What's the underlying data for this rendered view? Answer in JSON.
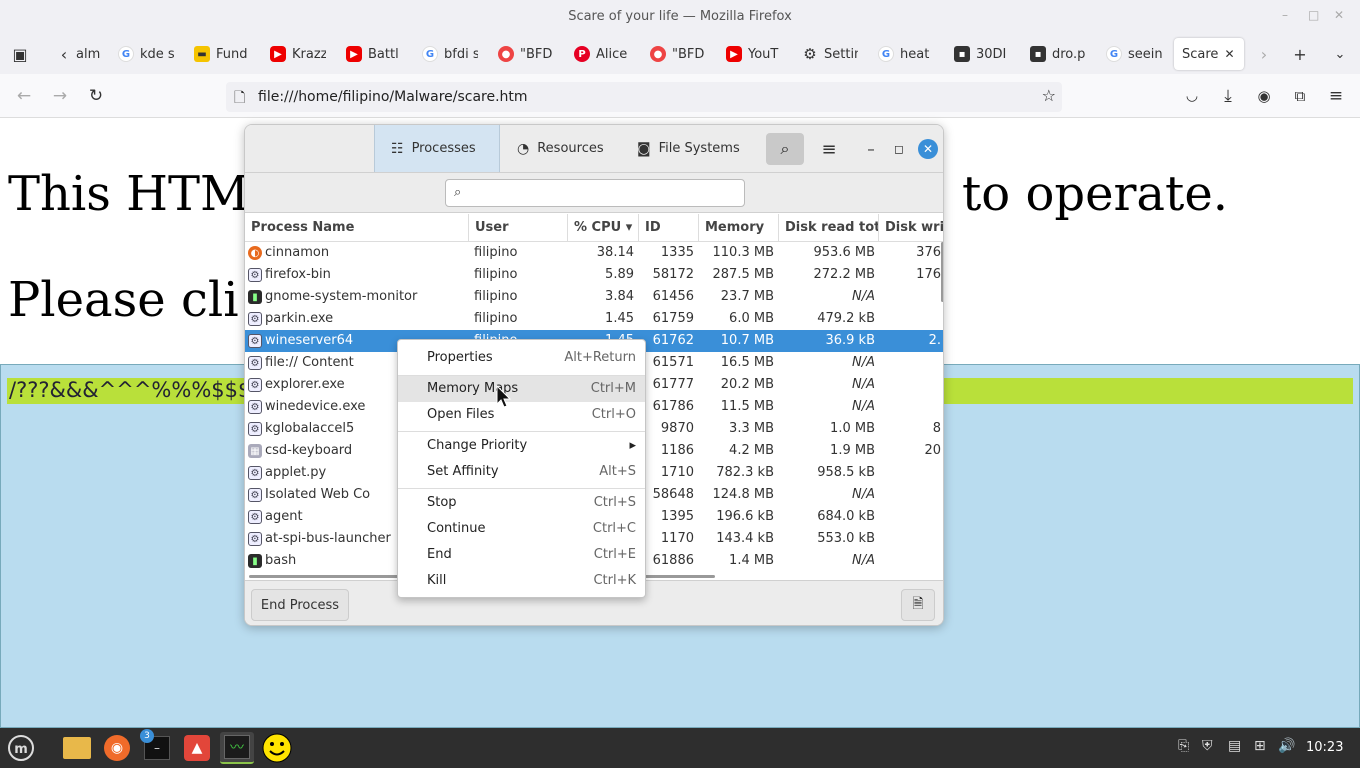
{
  "window": {
    "title": "Scare of your life — Mozilla Firefox",
    "min": "–",
    "max": "□",
    "close": "✕"
  },
  "tabs": [
    {
      "label": "alm",
      "icon": "back-history-icon"
    },
    {
      "label": "kde s",
      "icon": "google-icon"
    },
    {
      "label": "Fund",
      "icon": "fundraiser-icon"
    },
    {
      "label": "Krazz",
      "icon": "youtube-icon"
    },
    {
      "label": "Battl",
      "icon": "youtube-icon"
    },
    {
      "label": "bfdi s",
      "icon": "google-icon"
    },
    {
      "label": "\"BFD",
      "icon": "bfdi-icon"
    },
    {
      "label": "Alice",
      "icon": "pinterest-icon"
    },
    {
      "label": "\"BFD",
      "icon": "bfdi-icon"
    },
    {
      "label": "YouT",
      "icon": "youtube-icon"
    },
    {
      "label": "Settin",
      "icon": "gear-icon"
    },
    {
      "label": "heat",
      "icon": "google-icon"
    },
    {
      "label": "30DI",
      "icon": "thumbnail-icon"
    },
    {
      "label": "dro.p",
      "icon": "thumbnail-icon"
    },
    {
      "label": "seein",
      "icon": "google-icon"
    },
    {
      "label": "Scare",
      "icon": "page-icon",
      "active": true
    }
  ],
  "navbar": {
    "url": "file:///home/filipino/Malware/scare.htm"
  },
  "page": {
    "heading_1_left": "This HTM",
    "heading_1_right": "to operate.",
    "heading_2": "Please cli",
    "green_text": "/???&&&^^^%%%$$$"
  },
  "sysmon": {
    "tabs": [
      {
        "label": "Processes",
        "icon": "list-icon"
      },
      {
        "label": "Resources",
        "icon": "gauge-icon"
      },
      {
        "label": "File Systems",
        "icon": "disk-icon"
      }
    ],
    "search_placeholder": "",
    "columns": [
      "Process Name",
      "User",
      "% CPU",
      "ID",
      "Memory",
      "Disk read total",
      "Disk write"
    ],
    "sort_column": "% CPU",
    "processes": [
      {
        "name": "cinnamon",
        "user": "filipino",
        "cpu": "38.14",
        "id": "1335",
        "mem": "110.3 MB",
        "read": "953.6 MB",
        "write": "376",
        "icon": "orange"
      },
      {
        "name": "firefox-bin",
        "user": "filipino",
        "cpu": "5.89",
        "id": "58172",
        "mem": "287.5 MB",
        "read": "272.2 MB",
        "write": "176",
        "icon": "gear"
      },
      {
        "name": "gnome-system-monitor",
        "user": "filipino",
        "cpu": "3.84",
        "id": "61456",
        "mem": "23.7 MB",
        "read": "N/A",
        "write": "",
        "icon": "term"
      },
      {
        "name": "parkin.exe",
        "user": "filipino",
        "cpu": "1.45",
        "id": "61759",
        "mem": "6.0 MB",
        "read": "479.2 kB",
        "write": "",
        "icon": "gear"
      },
      {
        "name": "wineserver64",
        "user": "filipino",
        "cpu": "1.45",
        "id": "61762",
        "mem": "10.7 MB",
        "read": "36.9 kB",
        "write": "2.",
        "icon": "gear",
        "selected": true
      },
      {
        "name": "file:// Content",
        "user": "",
        "cpu": "",
        "id": "61571",
        "mem": "16.5 MB",
        "read": "N/A",
        "write": "",
        "icon": "gear"
      },
      {
        "name": "explorer.exe",
        "user": "",
        "cpu": "",
        "id": "61777",
        "mem": "20.2 MB",
        "read": "N/A",
        "write": "",
        "icon": "gear"
      },
      {
        "name": "winedevice.exe",
        "user": "",
        "cpu": "",
        "id": "61786",
        "mem": "11.5 MB",
        "read": "N/A",
        "write": "",
        "icon": "gear"
      },
      {
        "name": "kglobalaccel5",
        "user": "",
        "cpu": "",
        "id": "9870",
        "mem": "3.3 MB",
        "read": "1.0 MB",
        "write": "8",
        "icon": "gear"
      },
      {
        "name": "csd-keyboard",
        "user": "",
        "cpu": "",
        "id": "1186",
        "mem": "4.2 MB",
        "read": "1.9 MB",
        "write": "20",
        "icon": "kbd"
      },
      {
        "name": "applet.py",
        "user": "",
        "cpu": "",
        "id": "1710",
        "mem": "782.3 kB",
        "read": "958.5 kB",
        "write": "",
        "icon": "gear"
      },
      {
        "name": "Isolated Web Co",
        "user": "",
        "cpu": "",
        "id": "58648",
        "mem": "124.8 MB",
        "read": "N/A",
        "write": "",
        "icon": "gear"
      },
      {
        "name": "agent",
        "user": "",
        "cpu": "",
        "id": "1395",
        "mem": "196.6 kB",
        "read": "684.0 kB",
        "write": "",
        "icon": "gear"
      },
      {
        "name": "at-spi-bus-launcher",
        "user": "",
        "cpu": "",
        "id": "1170",
        "mem": "143.4 kB",
        "read": "553.0 kB",
        "write": "",
        "icon": "gear"
      },
      {
        "name": "bash",
        "user": "",
        "cpu": "",
        "id": "61886",
        "mem": "1.4 MB",
        "read": "N/A",
        "write": "",
        "icon": "term"
      }
    ],
    "end_process": "End Process"
  },
  "context_menu": {
    "items": [
      {
        "label": "Properties",
        "accel": "Alt+Return"
      },
      {
        "label": "Memory Maps",
        "accel": "Ctrl+M",
        "hover": true
      },
      {
        "label": "Open Files",
        "accel": "Ctrl+O"
      },
      {
        "label": "Change Priority",
        "accel": "▸"
      },
      {
        "label": "Set Affinity",
        "accel": "Alt+S"
      },
      {
        "label": "Stop",
        "accel": "Ctrl+S"
      },
      {
        "label": "Continue",
        "accel": "Ctrl+C"
      },
      {
        "label": "End",
        "accel": "Ctrl+E"
      },
      {
        "label": "Kill",
        "accel": "Ctrl+K"
      }
    ]
  },
  "taskbar": {
    "clock": "10:23",
    "terminal_badge": "3",
    "apps": [
      "menu-icon",
      "files-icon",
      "firefox-icon",
      "terminal-icon",
      "app-icon",
      "system-monitor-icon",
      "smiley-icon"
    ]
  }
}
